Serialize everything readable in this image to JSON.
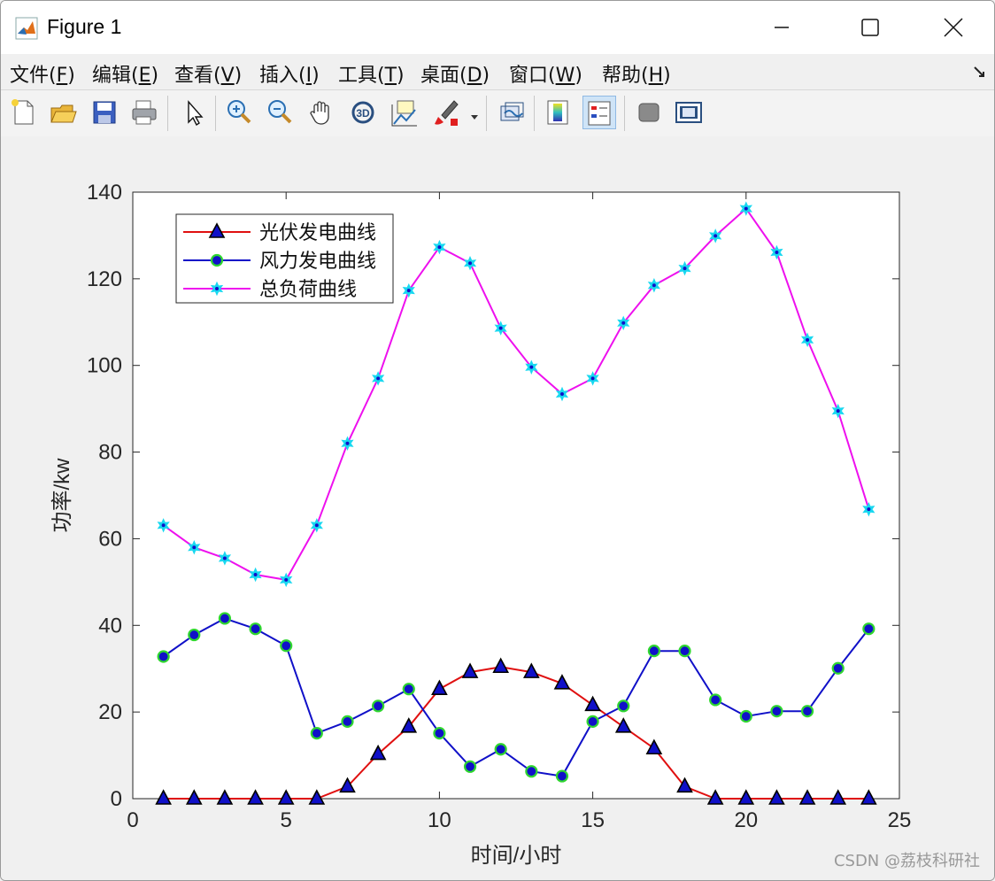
{
  "window": {
    "title": "Figure 1"
  },
  "menu": [
    {
      "label": "文件(",
      "key": "F",
      "end": ")"
    },
    {
      "label": "编辑(",
      "key": "E",
      "end": ")"
    },
    {
      "label": "查看(",
      "key": "V",
      "end": ")"
    },
    {
      "label": "插入(",
      "key": "I",
      "end": ")"
    },
    {
      "label": "工具(",
      "key": "T",
      "end": ")"
    },
    {
      "label": "桌面(",
      "key": "D",
      "end": ")"
    },
    {
      "label": "窗口(",
      "key": "W",
      "end": ")"
    },
    {
      "label": "帮助(",
      "key": "H",
      "end": ")"
    }
  ],
  "toolbar_icons": [
    "new-figure-icon",
    "open-file-icon",
    "save-icon",
    "print-icon",
    "pointer-icon",
    "zoom-in-icon",
    "zoom-out-icon",
    "pan-hand-icon",
    "rotate-3d-icon",
    "data-cursor-icon",
    "brush-icon",
    "link-plot-icon",
    "colorbar-icon",
    "legend-icon",
    "hide-plot-tools-icon",
    "show-plot-tools-icon"
  ],
  "watermark": "CSDN @荔枝科研社",
  "chart_data": {
    "type": "line",
    "xlabel": "时间/小时",
    "ylabel": "功率/kw",
    "xlim": [
      0,
      25
    ],
    "ylim": [
      0,
      140
    ],
    "xticks": [
      0,
      5,
      10,
      15,
      20,
      25
    ],
    "yticks": [
      0,
      20,
      40,
      60,
      80,
      100,
      120,
      140
    ],
    "grid": false,
    "legend_position": "top-left",
    "x": [
      1,
      2,
      3,
      4,
      5,
      6,
      7,
      8,
      9,
      10,
      11,
      12,
      13,
      14,
      15,
      16,
      17,
      18,
      19,
      20,
      21,
      22,
      23,
      24
    ],
    "series": [
      {
        "name": "光伏发电曲线",
        "color": "#e01010",
        "marker": "triangle",
        "marker_fill": "#1010c8",
        "marker_edge": "#000000",
        "values": [
          0,
          0,
          0,
          0,
          0,
          0,
          2.8,
          10.3,
          16.6,
          25.3,
          29.2,
          30.4,
          29.2,
          26.6,
          21.6,
          16.6,
          11.6,
          2.8,
          0,
          0,
          0,
          0,
          0,
          0
        ]
      },
      {
        "name": "风力发电曲线",
        "color": "#1010c8",
        "marker": "circle",
        "marker_fill": "#1010c8",
        "marker_edge": "#2fd62f",
        "values": [
          32.8,
          37.8,
          41.6,
          39.2,
          35.3,
          15.1,
          17.8,
          21.4,
          25.3,
          15.1,
          7.4,
          11.4,
          6.3,
          5.2,
          17.8,
          21.4,
          34.1,
          34.1,
          22.8,
          19.0,
          20.2,
          20.2,
          30.1,
          39.2
        ]
      },
      {
        "name": "总负荷曲线",
        "color": "#ee10ee",
        "marker": "star",
        "marker_fill": "#1010c8",
        "marker_edge": "#18d8f0",
        "values": [
          63.1,
          58.0,
          55.5,
          51.7,
          50.5,
          63.1,
          82.0,
          97.0,
          117.3,
          127.3,
          123.6,
          108.6,
          99.6,
          93.4,
          97.0,
          109.8,
          118.5,
          122.4,
          129.9,
          136.2,
          126.1,
          105.9,
          89.5,
          66.8
        ]
      }
    ]
  }
}
